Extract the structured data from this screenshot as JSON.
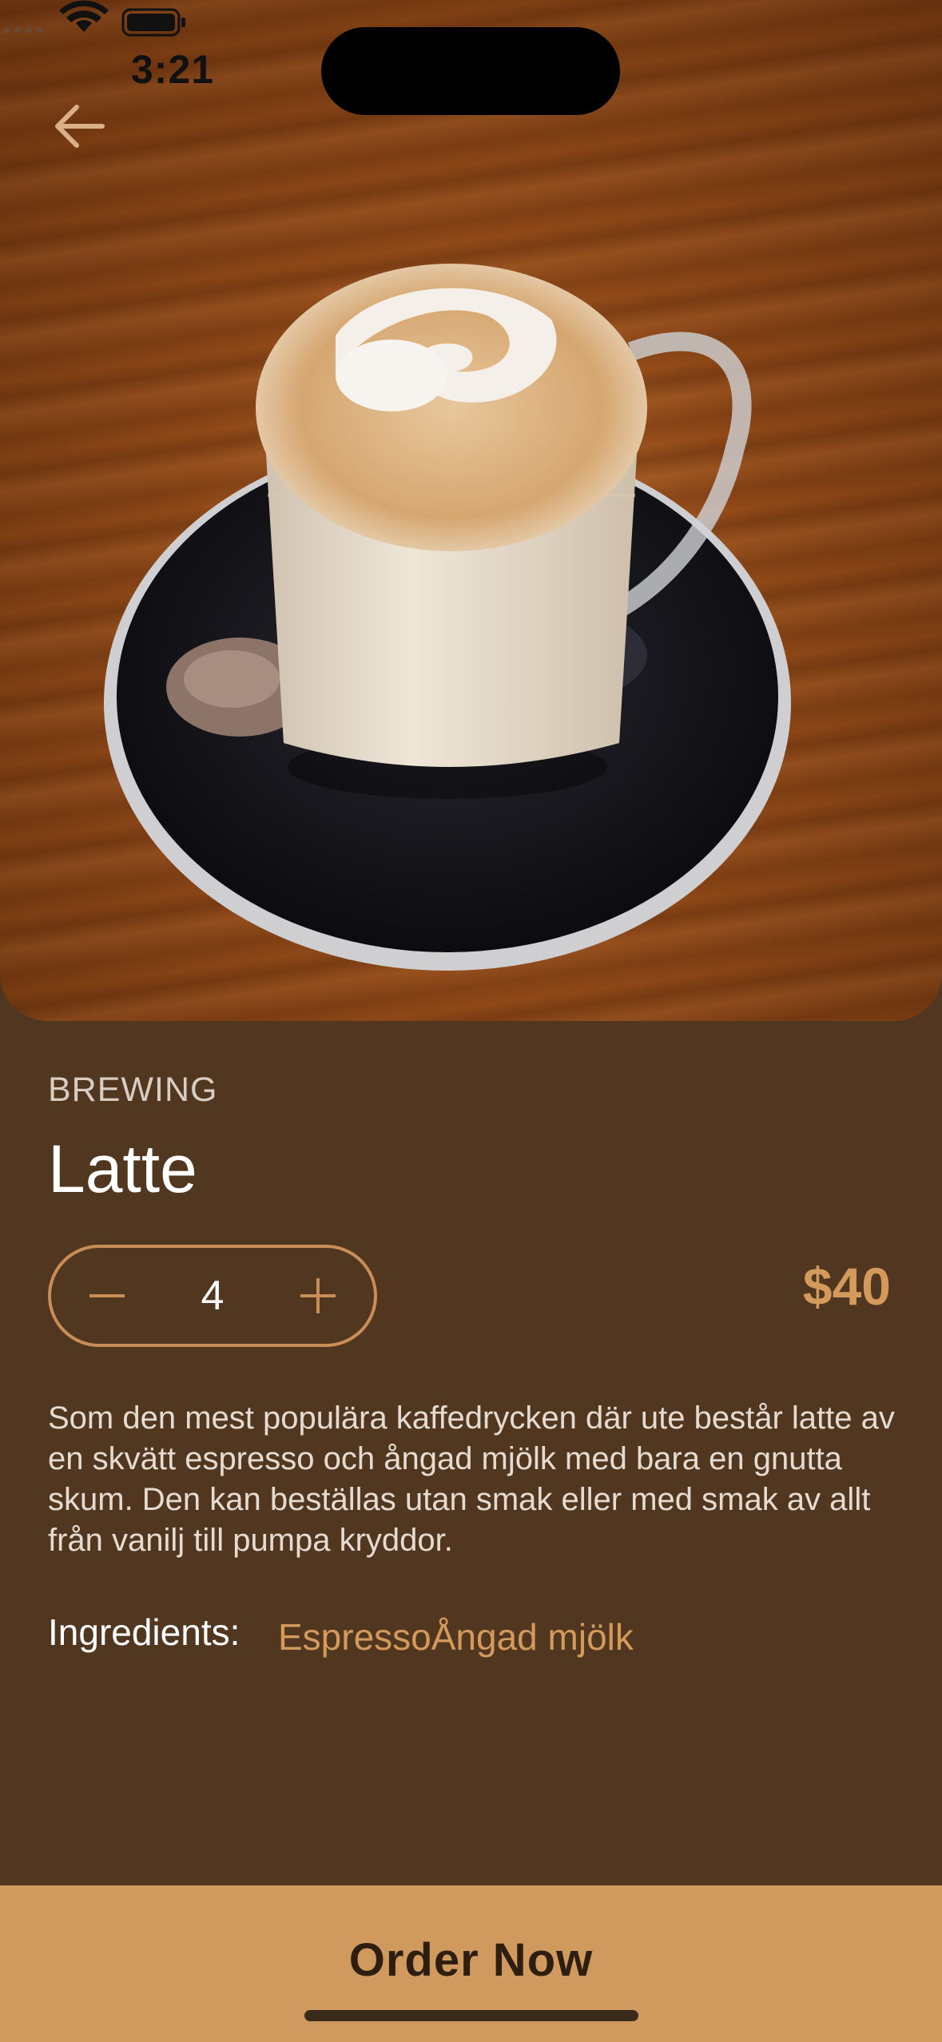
{
  "status_bar": {
    "time": "3:21"
  },
  "product": {
    "category": "BREWING",
    "name": "Latte",
    "quantity": "4",
    "price": "$40",
    "description": "Som den mest populära kaffedrycken där ute består latte av en skvätt espresso och ångad mjölk med bara en gnutta skum. Den kan beställas utan smak eller med smak av allt från vanilj till pumpa kryddor.",
    "ingredients_label": "Ingredients:",
    "ingredients": "EspressoÅngad mjölk"
  },
  "actions": {
    "order_label": "Order Now"
  },
  "colors": {
    "background": "#523720",
    "accent": "#d39a5b",
    "order_bar": "#d09a5f"
  },
  "icons": [
    "back-arrow-icon",
    "minus-icon",
    "plus-icon",
    "wifi-icon",
    "battery-icon",
    "signal-icon"
  ]
}
